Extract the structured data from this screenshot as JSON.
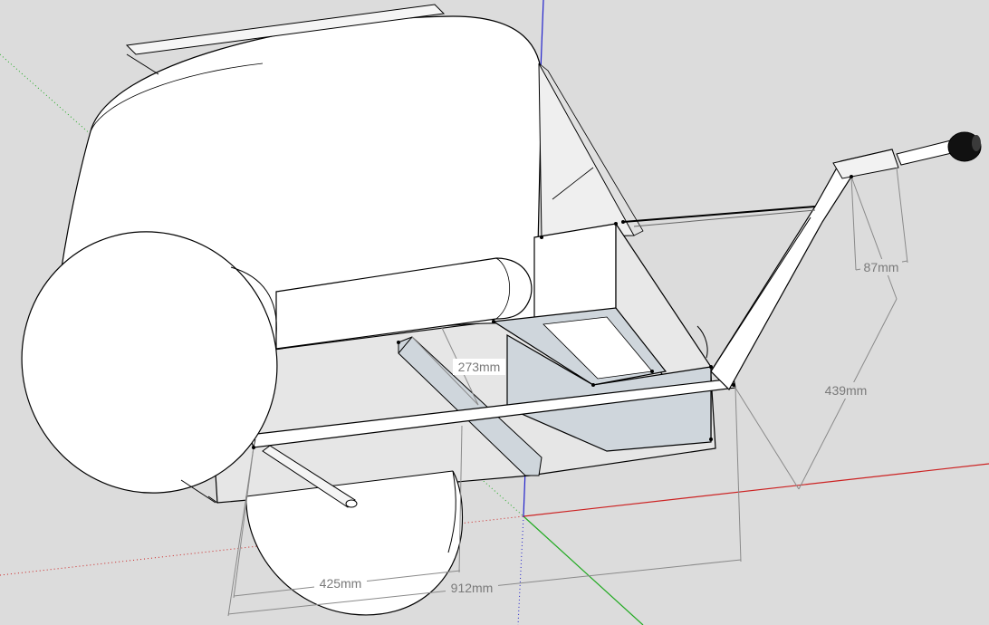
{
  "viewport": {
    "background": "#dcdcdc"
  },
  "axes": {
    "red": "#cc2222",
    "green": "#22aa22",
    "blue": "#2222cc"
  },
  "colors": {
    "face": "#ffffff",
    "face_shade": "#eeeeee",
    "frame_shade": "#cfd6dc",
    "edge": "#000000",
    "dimension": "#8a8a8a"
  },
  "dimensions": [
    {
      "label": "87mm"
    },
    {
      "label": "439mm"
    },
    {
      "label": "273mm"
    },
    {
      "label": "425mm"
    },
    {
      "label": "912mm"
    }
  ]
}
